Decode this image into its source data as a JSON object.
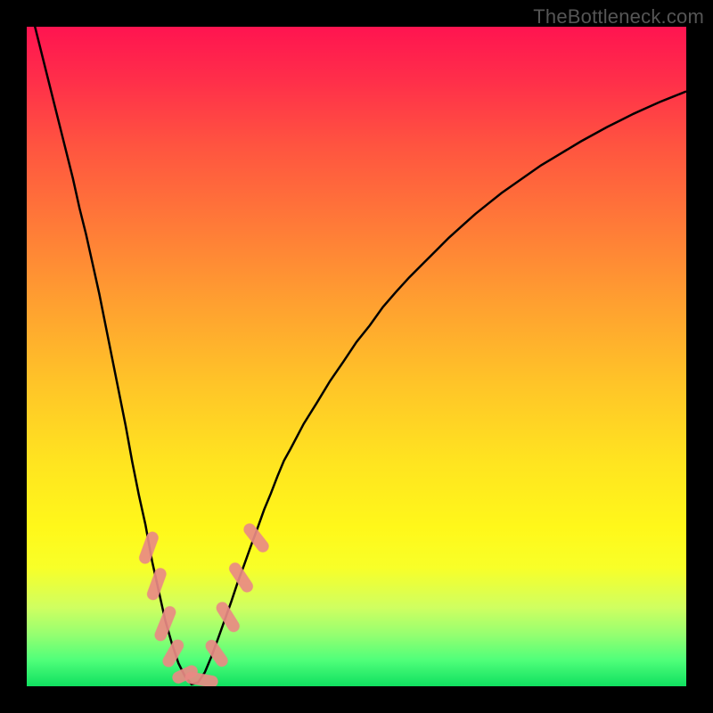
{
  "watermark": "TheBottleneck.com",
  "colors": {
    "frame": "#000000",
    "curve_stroke": "#000000",
    "marker_fill": "#e98a84",
    "marker_stroke": "#e98a84"
  },
  "chart_data": {
    "type": "line",
    "title": "",
    "xlabel": "",
    "ylabel": "",
    "xlim": [
      0,
      100
    ],
    "ylim": [
      0,
      100
    ],
    "grid": false,
    "legend": false,
    "x": [
      0,
      1,
      2,
      3,
      4,
      5,
      6,
      7,
      8,
      9,
      10,
      11,
      12,
      13,
      14,
      15,
      16,
      17,
      18,
      19,
      20,
      21,
      22,
      23,
      24,
      25,
      26,
      27,
      28,
      29,
      30,
      31,
      32,
      33,
      34,
      35,
      36,
      37,
      38,
      39,
      40,
      42,
      44,
      46,
      48,
      50,
      52,
      54,
      56,
      58,
      60,
      62,
      64,
      66,
      68,
      70,
      72,
      74,
      76,
      78,
      80,
      82,
      84,
      86,
      88,
      90,
      92,
      94,
      96,
      98,
      100
    ],
    "y": [
      104,
      101,
      97,
      93,
      89,
      85,
      81,
      77,
      72.5,
      68.5,
      64,
      59.5,
      54.5,
      49.5,
      44.5,
      39.5,
      34,
      29,
      24.5,
      19,
      14.5,
      10,
      6.5,
      3.5,
      1.5,
      0.3,
      0.6,
      2.1,
      4.5,
      7.2,
      10,
      12.8,
      15.8,
      18.5,
      21.3,
      24,
      26.8,
      29.2,
      31.8,
      34.2,
      36,
      39.8,
      43,
      46.3,
      49.2,
      52.2,
      54.7,
      57.5,
      59.8,
      62,
      64,
      66,
      68,
      69.8,
      71.6,
      73.2,
      74.8,
      76.2,
      77.6,
      79,
      80.2,
      81.4,
      82.6,
      83.7,
      84.8,
      85.8,
      86.8,
      87.7,
      88.6,
      89.4,
      90.2
    ],
    "markers": [
      {
        "x": 18.5,
        "y": 21.0,
        "len": 5.0,
        "angle": -70
      },
      {
        "x": 19.7,
        "y": 15.5,
        "len": 5.0,
        "angle": -70
      },
      {
        "x": 21.0,
        "y": 9.5,
        "len": 5.5,
        "angle": -68
      },
      {
        "x": 22.2,
        "y": 5.0,
        "len": 4.5,
        "angle": -60
      },
      {
        "x": 24.0,
        "y": 1.8,
        "len": 4.0,
        "angle": -25
      },
      {
        "x": 26.5,
        "y": 1.0,
        "len": 5.0,
        "angle": 10
      },
      {
        "x": 28.8,
        "y": 5.0,
        "len": 4.5,
        "angle": 55
      },
      {
        "x": 30.5,
        "y": 10.5,
        "len": 5.0,
        "angle": 58
      },
      {
        "x": 32.5,
        "y": 16.5,
        "len": 5.0,
        "angle": 56
      },
      {
        "x": 34.8,
        "y": 22.5,
        "len": 5.0,
        "angle": 52
      }
    ]
  }
}
